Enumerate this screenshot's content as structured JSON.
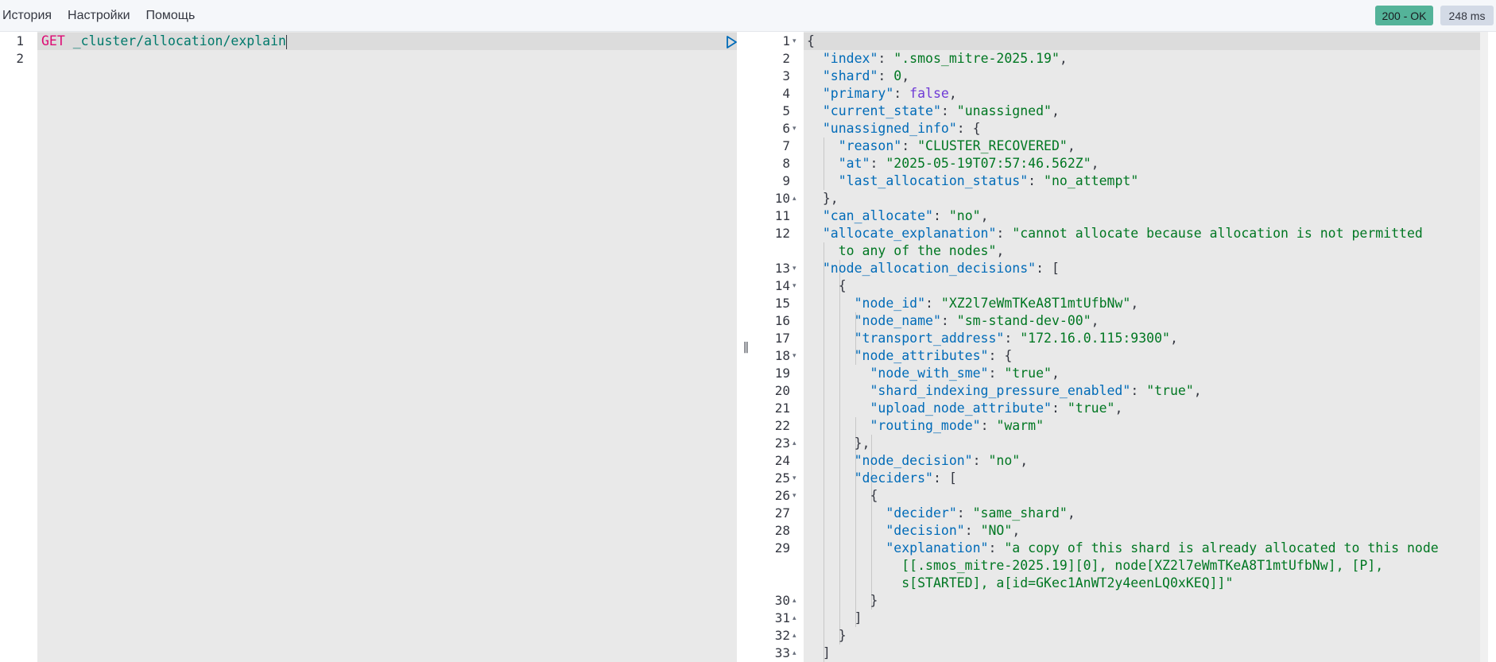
{
  "menu": {
    "items": [
      "История",
      "Настройки",
      "Помощь"
    ]
  },
  "status": {
    "code": "200 - OK",
    "time": "248 ms",
    "ok_color": "#54b399"
  },
  "request": {
    "method": "GET",
    "url": "_cluster/allocation/explain",
    "line_numbers": [
      "1",
      "2"
    ],
    "icons": {
      "run": "play-icon",
      "settings": "wrench-icon"
    }
  },
  "splitter": {
    "grip": "||"
  },
  "response": {
    "line_numbers": [
      "1",
      "2",
      "3",
      "4",
      "5",
      "6",
      "7",
      "8",
      "9",
      "10",
      "11",
      "12",
      "",
      "13",
      "14",
      "15",
      "16",
      "17",
      "18",
      "19",
      "20",
      "21",
      "22",
      "23",
      "24",
      "25",
      "26",
      "27",
      "28",
      "29",
      "",
      "",
      "30",
      "31",
      "32",
      "33"
    ],
    "lines": [
      [
        [
          "p",
          "{"
        ]
      ],
      [
        [
          "p",
          "  "
        ],
        [
          "k",
          "\"index\""
        ],
        [
          "p",
          ": "
        ],
        [
          "s",
          "\".smos_mitre-2025.19\""
        ],
        [
          "p",
          ","
        ]
      ],
      [
        [
          "p",
          "  "
        ],
        [
          "k",
          "\"shard\""
        ],
        [
          "p",
          ": "
        ],
        [
          "n",
          "0"
        ],
        [
          "p",
          ","
        ]
      ],
      [
        [
          "p",
          "  "
        ],
        [
          "k",
          "\"primary\""
        ],
        [
          "p",
          ": "
        ],
        [
          "b",
          "false"
        ],
        [
          "p",
          ","
        ]
      ],
      [
        [
          "p",
          "  "
        ],
        [
          "k",
          "\"current_state\""
        ],
        [
          "p",
          ": "
        ],
        [
          "s",
          "\"unassigned\""
        ],
        [
          "p",
          ","
        ]
      ],
      [
        [
          "p",
          "  "
        ],
        [
          "k",
          "\"unassigned_info\""
        ],
        [
          "p",
          ": {"
        ]
      ],
      [
        [
          "p",
          "    "
        ],
        [
          "k",
          "\"reason\""
        ],
        [
          "p",
          ": "
        ],
        [
          "s",
          "\"CLUSTER_RECOVERED\""
        ],
        [
          "p",
          ","
        ]
      ],
      [
        [
          "p",
          "    "
        ],
        [
          "k",
          "\"at\""
        ],
        [
          "p",
          ": "
        ],
        [
          "s",
          "\"2025-05-19T07:57:46.562Z\""
        ],
        [
          "p",
          ","
        ]
      ],
      [
        [
          "p",
          "    "
        ],
        [
          "k",
          "\"last_allocation_status\""
        ],
        [
          "p",
          ": "
        ],
        [
          "s",
          "\"no_attempt\""
        ]
      ],
      [
        [
          "p",
          "  },"
        ]
      ],
      [
        [
          "p",
          "  "
        ],
        [
          "k",
          "\"can_allocate\""
        ],
        [
          "p",
          ": "
        ],
        [
          "s",
          "\"no\""
        ],
        [
          "p",
          ","
        ]
      ],
      [
        [
          "p",
          "  "
        ],
        [
          "k",
          "\"allocate_explanation\""
        ],
        [
          "p",
          ": "
        ],
        [
          "s",
          "\"cannot allocate because allocation is not permitted"
        ]
      ],
      [
        [
          "s",
          "    to any of the nodes\""
        ],
        [
          "p",
          ","
        ]
      ],
      [
        [
          "p",
          "  "
        ],
        [
          "k",
          "\"node_allocation_decisions\""
        ],
        [
          "p",
          ": ["
        ]
      ],
      [
        [
          "p",
          "    {"
        ]
      ],
      [
        [
          "p",
          "      "
        ],
        [
          "k",
          "\"node_id\""
        ],
        [
          "p",
          ": "
        ],
        [
          "s",
          "\"XZ2l7eWmTKeA8T1mtUfbNw\""
        ],
        [
          "p",
          ","
        ]
      ],
      [
        [
          "p",
          "      "
        ],
        [
          "k",
          "\"node_name\""
        ],
        [
          "p",
          ": "
        ],
        [
          "s",
          "\"sm-stand-dev-00\""
        ],
        [
          "p",
          ","
        ]
      ],
      [
        [
          "p",
          "      "
        ],
        [
          "k",
          "\"transport_address\""
        ],
        [
          "p",
          ": "
        ],
        [
          "s",
          "\"172.16.0.115:9300\""
        ],
        [
          "p",
          ","
        ]
      ],
      [
        [
          "p",
          "      "
        ],
        [
          "k",
          "\"node_attributes\""
        ],
        [
          "p",
          ": {"
        ]
      ],
      [
        [
          "p",
          "        "
        ],
        [
          "k",
          "\"node_with_sme\""
        ],
        [
          "p",
          ": "
        ],
        [
          "s",
          "\"true\""
        ],
        [
          "p",
          ","
        ]
      ],
      [
        [
          "p",
          "        "
        ],
        [
          "k",
          "\"shard_indexing_pressure_enabled\""
        ],
        [
          "p",
          ": "
        ],
        [
          "s",
          "\"true\""
        ],
        [
          "p",
          ","
        ]
      ],
      [
        [
          "p",
          "        "
        ],
        [
          "k",
          "\"upload_node_attribute\""
        ],
        [
          "p",
          ": "
        ],
        [
          "s",
          "\"true\""
        ],
        [
          "p",
          ","
        ]
      ],
      [
        [
          "p",
          "        "
        ],
        [
          "k",
          "\"routing_mode\""
        ],
        [
          "p",
          ": "
        ],
        [
          "s",
          "\"warm\""
        ]
      ],
      [
        [
          "p",
          "      },"
        ]
      ],
      [
        [
          "p",
          "      "
        ],
        [
          "k",
          "\"node_decision\""
        ],
        [
          "p",
          ": "
        ],
        [
          "s",
          "\"no\""
        ],
        [
          "p",
          ","
        ]
      ],
      [
        [
          "p",
          "      "
        ],
        [
          "k",
          "\"deciders\""
        ],
        [
          "p",
          ": ["
        ]
      ],
      [
        [
          "p",
          "        {"
        ]
      ],
      [
        [
          "p",
          "          "
        ],
        [
          "k",
          "\"decider\""
        ],
        [
          "p",
          ": "
        ],
        [
          "s",
          "\"same_shard\""
        ],
        [
          "p",
          ","
        ]
      ],
      [
        [
          "p",
          "          "
        ],
        [
          "k",
          "\"decision\""
        ],
        [
          "p",
          ": "
        ],
        [
          "s",
          "\"NO\""
        ],
        [
          "p",
          ","
        ]
      ],
      [
        [
          "p",
          "          "
        ],
        [
          "k",
          "\"explanation\""
        ],
        [
          "p",
          ": "
        ],
        [
          "s",
          "\"a copy of this shard is already allocated to this node"
        ]
      ],
      [
        [
          "s",
          "            [[.smos_mitre-2025.19][0], node[XZ2l7eWmTKeA8T1mtUfbNw], [P],"
        ]
      ],
      [
        [
          "s",
          "            s[STARTED], a[id=GKec1AnWT2y4eenLQ0xKEQ]]\""
        ]
      ],
      [
        [
          "p",
          "        }"
        ]
      ],
      [
        [
          "p",
          "      ]"
        ]
      ],
      [
        [
          "p",
          "    }"
        ]
      ],
      [
        [
          "p",
          "  ]"
        ]
      ]
    ],
    "folds": {
      "1": "down",
      "6": "down",
      "10": "up",
      "13": "down",
      "14": "down",
      "18": "down",
      "23": "up",
      "25": "down",
      "26": "down",
      "30": "up",
      "31": "up",
      "32": "up",
      "33": "up"
    }
  }
}
